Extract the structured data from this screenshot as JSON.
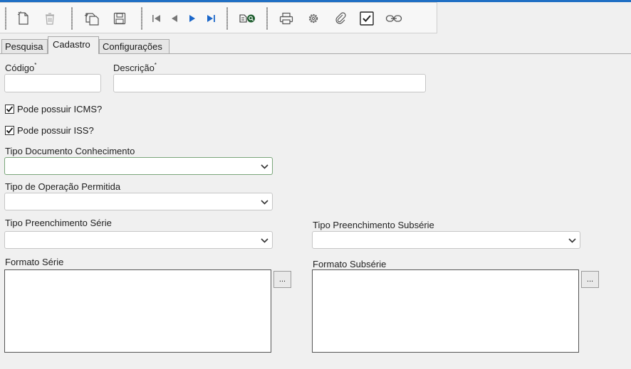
{
  "toolbar": {
    "buttons": [
      {
        "name": "new-icon",
        "tooltip": "Novo"
      },
      {
        "name": "delete-icon",
        "tooltip": "Excluir"
      },
      {
        "name": "copy-icon",
        "tooltip": "Copiar"
      },
      {
        "name": "save-icon",
        "tooltip": "Salvar"
      },
      {
        "name": "first-record-icon"
      },
      {
        "name": "previous-record-icon"
      },
      {
        "name": "next-record-icon"
      },
      {
        "name": "last-record-icon"
      },
      {
        "name": "search-icon"
      },
      {
        "name": "print-icon"
      },
      {
        "name": "settings-icon"
      },
      {
        "name": "attach-icon"
      },
      {
        "name": "checkbox-icon"
      },
      {
        "name": "link-icon"
      }
    ]
  },
  "tabs": [
    {
      "label": "Pesquisa"
    },
    {
      "label": "Cadastro"
    },
    {
      "label": "Configurações"
    }
  ],
  "form": {
    "codigo": {
      "label": "Código",
      "required": "*",
      "value": ""
    },
    "descricao": {
      "label": "Descrição",
      "required": "*",
      "value": ""
    },
    "icms": {
      "label": "Pode possuir ICMS?",
      "checked": true
    },
    "iss": {
      "label": "Pode possuir ISS?",
      "checked": true
    },
    "tipo_documento": {
      "label": "Tipo Documento Conhecimento",
      "value": ""
    },
    "tipo_operacao": {
      "label": "Tipo de Operação Permitida",
      "value": ""
    },
    "tipo_serie": {
      "label": "Tipo Preenchimento Série",
      "value": ""
    },
    "tipo_subserie": {
      "label": "Tipo Preenchimento Subsérie",
      "value": ""
    },
    "formato_serie": {
      "label": "Formato Série",
      "value": "",
      "button": "..."
    },
    "formato_subserie": {
      "label": "Formato Subsérie",
      "value": "",
      "button": "..."
    }
  },
  "colors": {
    "accent": "#1f6fc4",
    "nav_blue": "#1a66c9",
    "icon_gray": "#5a5a5a"
  }
}
